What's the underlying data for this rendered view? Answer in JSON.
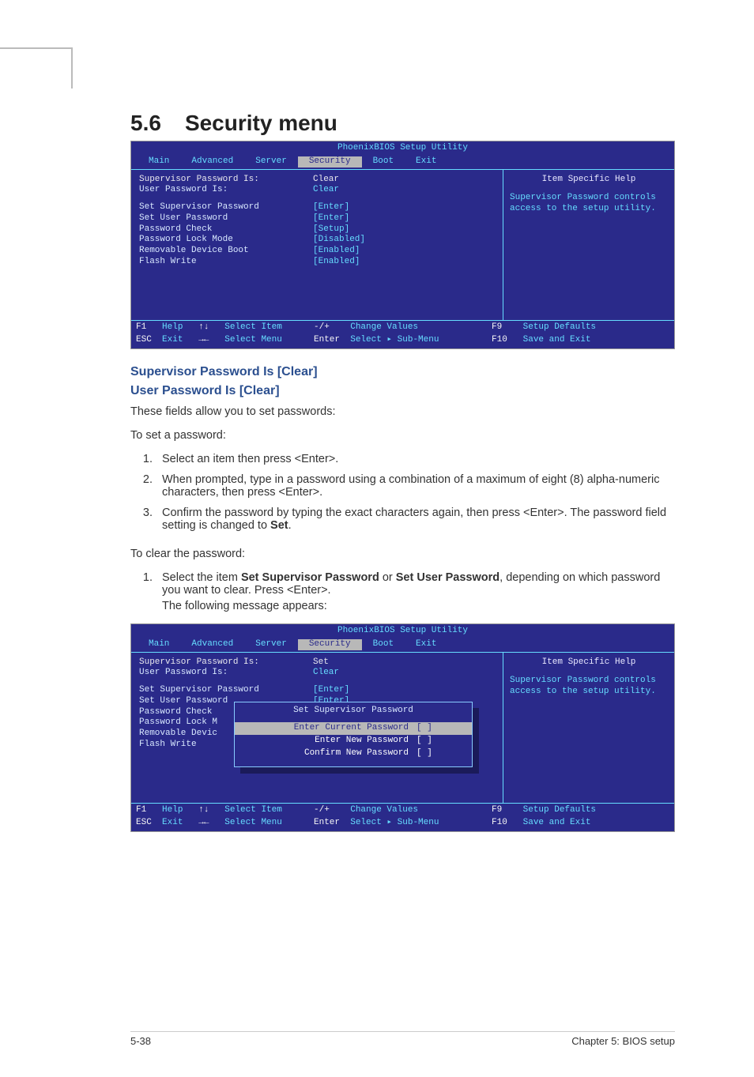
{
  "section": {
    "number": "5.6",
    "title": "Security menu"
  },
  "bios1": {
    "title": "PhoenixBIOS Setup Utility",
    "menu": {
      "main": "Main",
      "advanced": "Advanced",
      "server": "Server",
      "security": "Security",
      "boot": "Boot",
      "exit": "Exit"
    },
    "rows": {
      "r0l": "Supervisor Password Is:",
      "r0v": "Clear",
      "r1l": "User Password Is:",
      "r1v": "Clear",
      "r2l": "Set Supervisor Password",
      "r2v": "[Enter]",
      "r3l": "Set User Password",
      "r3v": "[Enter]",
      "r4l": "Password Check",
      "r4v": "[Setup]",
      "r5l": "Password Lock Mode",
      "r5v": "[Disabled]",
      "r6l": "Removable Device Boot",
      "r6v": "[Enabled]",
      "r7l": "Flash Write",
      "r7v": "[Enabled]"
    },
    "help": {
      "title": "Item Specific Help",
      "text": "Supervisor Password controls access to the setup utility."
    },
    "footer": {
      "f1k": "F1",
      "f1t": "Help",
      "udk": "↑↓",
      "udt": "Select Item",
      "mpk": "-/+",
      "mpt": "Change Values",
      "f9k": "F9",
      "f9t": "Setup Defaults",
      "esck": "ESC",
      "esct": "Exit",
      "lrk": "→←",
      "lrt": "Select Menu",
      "entk": "Enter",
      "entt": "Select ▸ Sub-Menu",
      "f10k": "F10",
      "f10t": "Save and Exit"
    }
  },
  "headings": {
    "h1": "Supervisor Password Is [Clear]",
    "h2": "User Password Is [Clear]"
  },
  "paras": {
    "p1": "These fields allow you to set passwords:",
    "p2": "To set a password:",
    "p3": "To clear the password:"
  },
  "list1": {
    "i1": "Select an item then press <Enter>.",
    "i2": "When prompted, type in a password using a combination of a maximum of eight (8) alpha-numeric characters, then press <Enter>.",
    "i3a": "Confirm the password by typing the exact characters again, then press <Enter>. The password field setting is changed to ",
    "i3b": "Set",
    "i3c": "."
  },
  "list2": {
    "i1a": "Select the item ",
    "i1b": "Set Supervisor Password",
    "i1c": " or ",
    "i1d": "Set User Password",
    "i1e": ", depending on which password you want to clear. Press <Enter>.",
    "sub": "The following message appears:"
  },
  "bios2": {
    "title": "PhoenixBIOS Setup Utility",
    "rows": {
      "r0l": "Supervisor Password Is:",
      "r0v": "Set",
      "r1l": "User Password Is:",
      "r1v": "Clear",
      "r2l": "Set Supervisor Password",
      "r2v": "[Enter]",
      "r3l": "Set User Password",
      "r3v": "[Enter]",
      "r4l": "Password Check",
      "r5l": "Password Lock M",
      "r6l": "Removable Devic",
      "r7l": "Flash Write"
    },
    "help_tail": "ility.",
    "popup": {
      "title": "Set Supervisor Password",
      "r0l": "Enter Current Password",
      "r0v": "[       ]",
      "r1l": "Enter New Password",
      "r1v": "[       ]",
      "r2l": "Confirm New Password",
      "r2v": "[       ]"
    }
  },
  "footer": {
    "left": "5-38",
    "right": "Chapter 5: BIOS setup"
  }
}
